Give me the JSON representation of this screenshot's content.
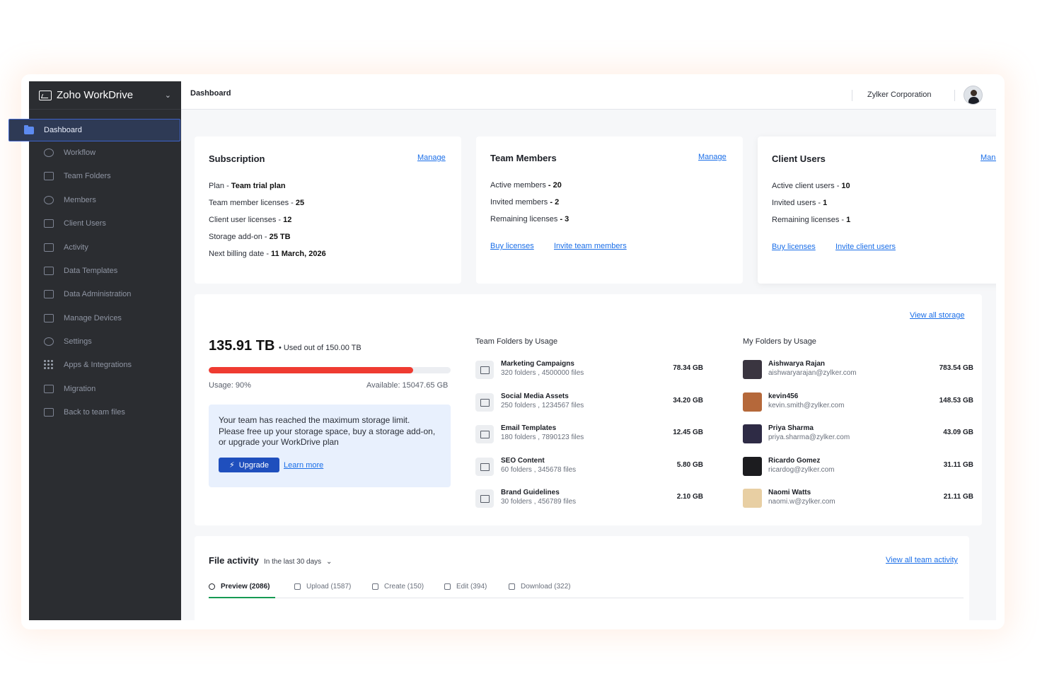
{
  "app": {
    "name": "Zoho WorkDrive"
  },
  "sidebar": {
    "active": "Dashboard",
    "items": [
      "Workflow",
      "Team Folders",
      "Members",
      "Client Users",
      "Activity",
      "Data Templates",
      "Data Administration",
      "Manage Devices",
      "Settings",
      "Apps & Integrations",
      "Migration",
      "Back to team files"
    ]
  },
  "header": {
    "title": "Dashboard",
    "org": "Zylker Corporation"
  },
  "subscription": {
    "title": "Subscription",
    "manage": "Manage",
    "rows": [
      {
        "label": "Plan - ",
        "value": "Team trial plan"
      },
      {
        "label": "Team member licenses - ",
        "value": "25"
      },
      {
        "label": "Client user licenses - ",
        "value": "12"
      },
      {
        "label": "Storage add-on - ",
        "value": "25 TB"
      },
      {
        "label": "Next billing date - ",
        "value": "11 March, 2026"
      }
    ]
  },
  "team_members": {
    "title": "Team Members",
    "manage": "Manage",
    "rows": [
      {
        "label": "Active members ",
        "value": "- 20"
      },
      {
        "label": "Invited members ",
        "value": "- 2"
      },
      {
        "label": "Remaining licenses ",
        "value": "- 3"
      }
    ],
    "links": [
      "Buy licenses",
      "Invite team members"
    ]
  },
  "client_users": {
    "title": "Client Users",
    "manage": "Manage",
    "rows": [
      {
        "label": "Active client users - ",
        "value": "10"
      },
      {
        "label": "Invited users - ",
        "value": "1"
      },
      {
        "label": "Remaining licenses - ",
        "value": "1"
      }
    ],
    "links": [
      "Buy licenses",
      "Invite client users"
    ]
  },
  "storage": {
    "view_all": "View all storage",
    "used": "135.91 TB",
    "used_suffix": "• Used out of 150.00 TB",
    "usage_fraction": 0.9,
    "usage_label": "Usage: 90%",
    "available_label": "Available: 15047.65 GB",
    "alert_text": "Your team has reached the maximum storage limit. Please free up your storage space, buy a storage add-on, or upgrade your WorkDrive plan",
    "upgrade_label": "Upgrade",
    "learn_more": "Learn more",
    "team_title": "Team Folders by Usage",
    "team_folders": [
      {
        "name": "Marketing Campaigns",
        "sub": "320 folders , 4500000 files",
        "size": "78.34 GB"
      },
      {
        "name": "Social Media Assets",
        "sub": "250 folders , 1234567 files",
        "size": "34.20 GB"
      },
      {
        "name": "Email Templates",
        "sub": "180 folders , 7890123 files",
        "size": "12.45 GB"
      },
      {
        "name": "SEO Content",
        "sub": "60 folders , 345678 files",
        "size": "5.80 GB"
      },
      {
        "name": "Brand Guidelines",
        "sub": "30 folders , 456789 files",
        "size": "2.10 GB"
      }
    ],
    "my_title": "My Folders by Usage",
    "my_folders": [
      {
        "name": "Aishwarya Rajan",
        "sub": "aishwaryarajan@zylker.com",
        "size": "783.54 GB",
        "color": "#3a3540"
      },
      {
        "name": "kevin456",
        "sub": "kevin.smith@zylker.com",
        "size": "148.53 GB",
        "color": "#b5683a"
      },
      {
        "name": "Priya Sharma",
        "sub": "priya.sharma@zylker.com",
        "size": "43.09 GB",
        "color": "#2e2b45"
      },
      {
        "name": "Ricardo Gomez",
        "sub": "ricardog@zylker.com",
        "size": "31.11 GB",
        "color": "#1c1c1f"
      },
      {
        "name": "Naomi Watts",
        "sub": "naomi.w@zylker.com",
        "size": "21.11 GB",
        "color": "#e8cfa3"
      }
    ]
  },
  "activity": {
    "title": "File activity",
    "range": "In the last 30 days",
    "view_all": "View all team activity",
    "tabs": [
      "Preview (2086)",
      "Upload (1587)",
      "Create (150)",
      "Edit (394)",
      "Download (322)"
    ]
  }
}
